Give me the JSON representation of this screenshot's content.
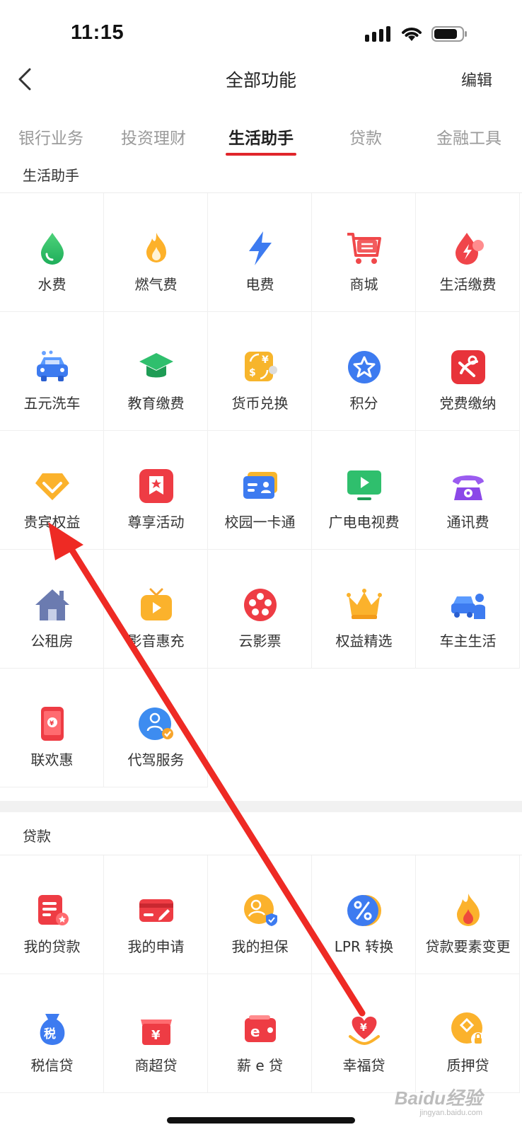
{
  "status": {
    "time": "11:15"
  },
  "nav": {
    "title": "全部功能",
    "edit_label": "编辑"
  },
  "tabs": [
    {
      "label": "银行业务",
      "active": false
    },
    {
      "label": "投资理财",
      "active": false
    },
    {
      "label": "生活助手",
      "active": true
    },
    {
      "label": "贷款",
      "active": false
    },
    {
      "label": "金融工具",
      "active": false
    }
  ],
  "sections": {
    "life": {
      "title": "生活助手",
      "items": [
        {
          "label": "水费",
          "icon": "water-drop-icon"
        },
        {
          "label": "燃气费",
          "icon": "flame-icon"
        },
        {
          "label": "电费",
          "icon": "lightning-icon"
        },
        {
          "label": "商城",
          "icon": "shopping-cart-icon"
        },
        {
          "label": "生活缴费",
          "icon": "payment-drop-icon"
        },
        {
          "label": "五元洗车",
          "icon": "car-wash-icon"
        },
        {
          "label": "教育缴费",
          "icon": "graduation-cap-icon"
        },
        {
          "label": "货币兑换",
          "icon": "currency-exchange-icon"
        },
        {
          "label": "积分",
          "icon": "star-badge-icon"
        },
        {
          "label": "党费缴纳",
          "icon": "party-emblem-icon"
        },
        {
          "label": "贵宾权益",
          "icon": "vip-diamond-icon"
        },
        {
          "label": "尊享活动",
          "icon": "star-ribbon-icon"
        },
        {
          "label": "校园一卡通",
          "icon": "id-card-icon"
        },
        {
          "label": "广电电视费",
          "icon": "tv-play-icon"
        },
        {
          "label": "通讯费",
          "icon": "telephone-icon"
        },
        {
          "label": "公租房",
          "icon": "house-icon"
        },
        {
          "label": "影音惠充",
          "icon": "video-tv-icon"
        },
        {
          "label": "云影票",
          "icon": "film-reel-icon"
        },
        {
          "label": "权益精选",
          "icon": "crown-icon"
        },
        {
          "label": "车主生活",
          "icon": "car-owner-icon"
        },
        {
          "label": "联欢惠",
          "icon": "phone-coupon-icon"
        },
        {
          "label": "代驾服务",
          "icon": "driver-service-icon"
        }
      ]
    },
    "loans": {
      "title": "贷款",
      "items": [
        {
          "label": "我的贷款",
          "icon": "loan-document-icon"
        },
        {
          "label": "我的申请",
          "icon": "application-card-icon"
        },
        {
          "label": "我的担保",
          "icon": "guarantee-icon"
        },
        {
          "label": "LPR 转换",
          "icon": "percent-icon"
        },
        {
          "label": "贷款要素变更",
          "icon": "flame-change-icon"
        },
        {
          "label": "税信贷",
          "icon": "tax-bag-icon"
        },
        {
          "label": "商超贷",
          "icon": "store-loan-icon"
        },
        {
          "label": "薪 e 贷",
          "icon": "salary-wallet-icon"
        },
        {
          "label": "幸福贷",
          "icon": "heart-yuan-icon"
        },
        {
          "label": "质押贷",
          "icon": "pledge-lock-icon"
        }
      ]
    }
  },
  "watermark": {
    "text": "Baidu经验",
    "sub": "jingyan.baidu.com"
  },
  "colors": {
    "accent": "#e0262b",
    "arrow": "#ee2a24"
  }
}
